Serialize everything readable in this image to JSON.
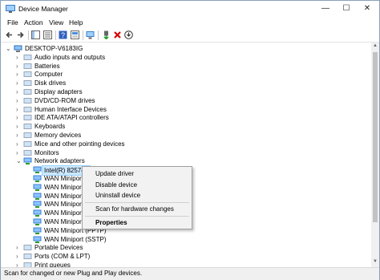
{
  "window": {
    "title": "Device Manager"
  },
  "title_buttons": {
    "minimize": "—",
    "maximize": "☐",
    "close": "✕"
  },
  "menu": [
    "File",
    "Action",
    "View",
    "Help"
  ],
  "tree": {
    "root": "DESKTOP-V6183IG",
    "categories": [
      "Audio inputs and outputs",
      "Batteries",
      "Computer",
      "Disk drives",
      "Display adapters",
      "DVD/CD-ROM drives",
      "Human Interface Devices",
      "IDE ATA/ATAPI controllers",
      "Keyboards",
      "Memory devices",
      "Mice and other pointing devices",
      "Monitors",
      "Network adapters"
    ],
    "network_devices": [
      "Intel(R) 82574L",
      "WAN Miniport",
      "WAN Miniport",
      "WAN Miniport",
      "WAN Miniport",
      "WAN Miniport",
      "WAN Miniport",
      "WAN Miniport (PPTP)",
      "WAN Miniport (SSTP)"
    ],
    "after": [
      "Portable Devices",
      "Ports (COM & LPT)",
      "Print queues"
    ]
  },
  "context_menu": {
    "update": "Update driver",
    "disable": "Disable device",
    "uninstall": "Uninstall device",
    "scan": "Scan for hardware changes",
    "properties": "Properties"
  },
  "status": "Scan for changed or new Plug and Play devices.",
  "colors": {
    "accent": "#1e78d7",
    "selection": "#cce8ff",
    "remove_red": "#d40000",
    "enable_green": "#2a9d2a"
  }
}
